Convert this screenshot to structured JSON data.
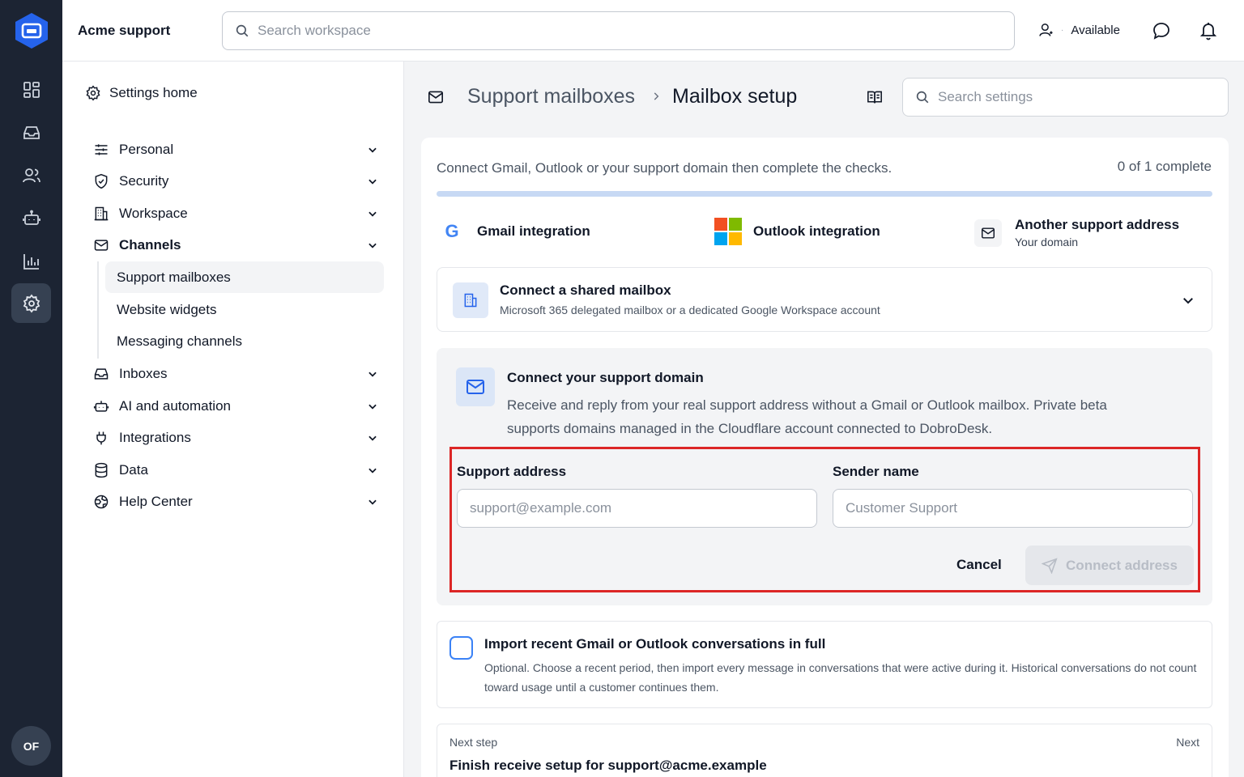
{
  "app": {
    "name": "Acme support",
    "avatar_initials": "OF"
  },
  "topbar": {
    "search_placeholder": "Search workspace",
    "status_label": "Available",
    "status_separator": "·"
  },
  "rail": {
    "items": [
      "dashboard-icon",
      "inbox-icon",
      "contacts-icon",
      "bot-icon",
      "reports-icon",
      "settings-icon"
    ],
    "active": "settings-icon"
  },
  "sidebar": {
    "home_label": "Settings home",
    "items": [
      {
        "label": "Personal",
        "icon": "sliders-icon"
      },
      {
        "label": "Security",
        "icon": "shield-icon"
      },
      {
        "label": "Workspace",
        "icon": "building-icon"
      },
      {
        "label": "Channels",
        "icon": "mail-icon",
        "expanded": true
      },
      {
        "label": "Inboxes",
        "icon": "inbox-icon"
      },
      {
        "label": "AI and automation",
        "icon": "bot-icon"
      },
      {
        "label": "Integrations",
        "icon": "plug-icon"
      },
      {
        "label": "Data",
        "icon": "database-icon"
      },
      {
        "label": "Help Center",
        "icon": "globe-icon"
      }
    ],
    "channel_subitems": [
      {
        "label": "Support mailboxes",
        "active": true
      },
      {
        "label": "Website widgets"
      },
      {
        "label": "Messaging channels"
      }
    ]
  },
  "breadcrumb": {
    "parent": "Support mailboxes",
    "current": "Mailbox setup"
  },
  "settings_search_placeholder": "Search settings",
  "setup": {
    "intro": "Connect Gmail, Outlook or your support domain then complete the checks.",
    "progress_label": "0 of 1 complete",
    "progress_fraction": 0,
    "options": {
      "gmail": {
        "logo": "G",
        "label": "Gmail integration"
      },
      "outlook": {
        "label": "Outlook integration"
      },
      "domain": {
        "label": "Another support address",
        "sub": "Your domain"
      }
    },
    "shared_mailbox": {
      "title": "Connect a shared mailbox",
      "desc": "Microsoft 365 delegated mailbox or a dedicated Google Workspace account"
    },
    "support_domain": {
      "title": "Connect your support domain",
      "desc": "Receive and reply from your real support address without a Gmail or Outlook mailbox. Private beta supports domains managed in the Cloudflare account connected to DobroDesk.",
      "address_label": "Support address",
      "address_placeholder": "support@example.com",
      "sender_label": "Sender name",
      "sender_placeholder": "Customer Support",
      "cancel_label": "Cancel",
      "connect_label": "Connect address"
    },
    "import": {
      "title": "Import recent Gmail or Outlook conversations in full",
      "desc": "Optional. Choose a recent period, then import every message in conversations that were active during it. Historical conversations do not count toward usage until a customer continues them.",
      "checked": false
    },
    "next_step": {
      "label": "Next step",
      "right": "Next",
      "title": "Finish receive setup for support@acme.example"
    }
  },
  "colors": {
    "rail_bg": "#1c2433",
    "accent": "#3b82f6",
    "highlight_border": "#dc2626",
    "ms_red": "#f25022",
    "ms_green": "#7fba00",
    "ms_blue": "#00a4ef",
    "ms_yellow": "#ffb900"
  }
}
